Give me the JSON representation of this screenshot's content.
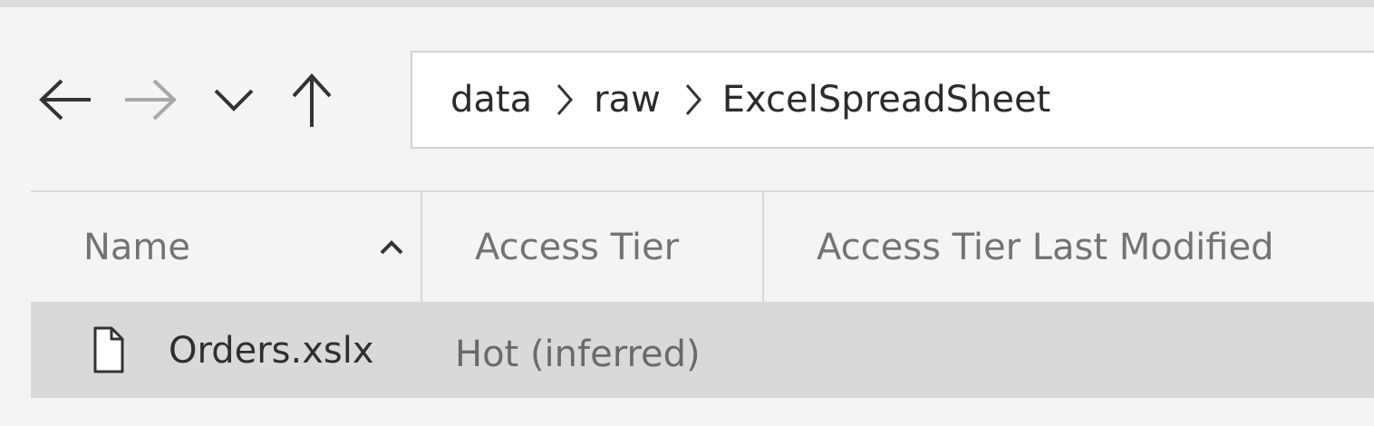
{
  "nav": {
    "back_icon": "arrow-left-icon",
    "forward_icon": "arrow-right-icon",
    "recent_icon": "chevron-down-icon",
    "up_icon": "arrow-up-icon"
  },
  "address_bar": {
    "crumbs": [
      "data",
      "raw",
      "ExcelSpreadSheet"
    ],
    "separator_icon": "chevron-right-icon"
  },
  "table": {
    "columns": [
      "Name",
      "Access Tier",
      "Access Tier Last Modified"
    ],
    "sort_column": "Name",
    "sort_direction": "ascending",
    "sort_icon": "chevron-up-icon",
    "rows": [
      {
        "icon": "file-icon",
        "name": "Orders.xslx",
        "access_tier": "Hot (inferred)",
        "access_tier_last_modified": "",
        "selected": true
      }
    ]
  },
  "colors": {
    "background": "#f4f4f4",
    "selected_row": "#d9d9d9",
    "header_text": "#737373",
    "text": "#2b2b2b",
    "disabled_icon": "#a8a8a8"
  }
}
